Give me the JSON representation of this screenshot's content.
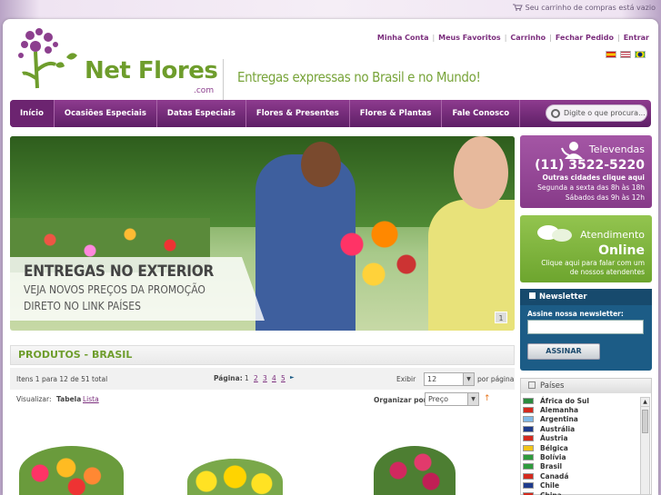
{
  "cart": {
    "text": "Seu carrinho de compras está vazio"
  },
  "brand": {
    "name": "Net Flores",
    "suffix": ".com",
    "tagline": "Entregas expressas no Brasil e no Mundo!"
  },
  "user_menu": [
    "Minha Conta",
    "Meus Favoritos",
    "Carrinho",
    "Fechar Pedido",
    "Entrar"
  ],
  "flags": [
    {
      "name": "spanish-flag-icon",
      "color": "#e8b400"
    },
    {
      "name": "english-flag-icon",
      "color": "#3b4f9b"
    },
    {
      "name": "brazil-flag-icon",
      "color": "#2f9b3d"
    }
  ],
  "nav": {
    "items": [
      "Início",
      "Ocasiões Especiais",
      "Datas Especiais",
      "Flores & Presentes",
      "Flores & Plantas",
      "Fale Conosco"
    ],
    "search_placeholder": "Digite o que procura..."
  },
  "banner": {
    "line1": "ENTREGAS NO EXTERIOR",
    "line2": "VEJA NOVOS PREÇOS DA PROMOÇÃO",
    "line3": "DIRETO NO LINK PAÍSES",
    "page": "1"
  },
  "televendas": {
    "title": "Televendas",
    "phone": "(11) 3522-5220",
    "other": "Outras cidades clique aqui",
    "hours1": "Segunda a sexta das 8h às 18h",
    "hours2": "Sábados das 9h às 12h"
  },
  "atendimento": {
    "title": "Atendimento",
    "status": "Online",
    "desc1": "Clique aqui para falar com um",
    "desc2": "de nossos atendentes"
  },
  "newsletter": {
    "title": "Newsletter",
    "label": "Assine nossa newsletter:",
    "button": "ASSINAR"
  },
  "paises": {
    "title": "Países",
    "items": [
      {
        "name": "África do Sul",
        "color": "#2b8a3e"
      },
      {
        "name": "Alemanha",
        "color": "#d42a1e"
      },
      {
        "name": "Argentina",
        "color": "#7fb8e6"
      },
      {
        "name": "Austrália",
        "color": "#1f3b8c"
      },
      {
        "name": "Áustria",
        "color": "#d42a1e"
      },
      {
        "name": "Bélgica",
        "color": "#f0c419"
      },
      {
        "name": "Bolívia",
        "color": "#2f9b3d"
      },
      {
        "name": "Brasil",
        "color": "#2f9b3d"
      },
      {
        "name": "Canadá",
        "color": "#d42a1e"
      },
      {
        "name": "Chile",
        "color": "#1f3b8c"
      },
      {
        "name": "China",
        "color": "#d42a1e"
      }
    ]
  },
  "products": {
    "title": "PRODUTOS - BRASIL",
    "items_text": "Itens 1 para 12 de 51 total",
    "page_label": "Página:",
    "pages": [
      "1",
      "2",
      "3",
      "4",
      "5"
    ],
    "next": "►",
    "show_label": "Exibir",
    "show_value": "12",
    "per_page": "por página",
    "view_label": "Visualizar:",
    "view_table": "Tabela",
    "view_list": "Lista",
    "sort_label": "Organizar por",
    "sort_value": "Preço"
  }
}
